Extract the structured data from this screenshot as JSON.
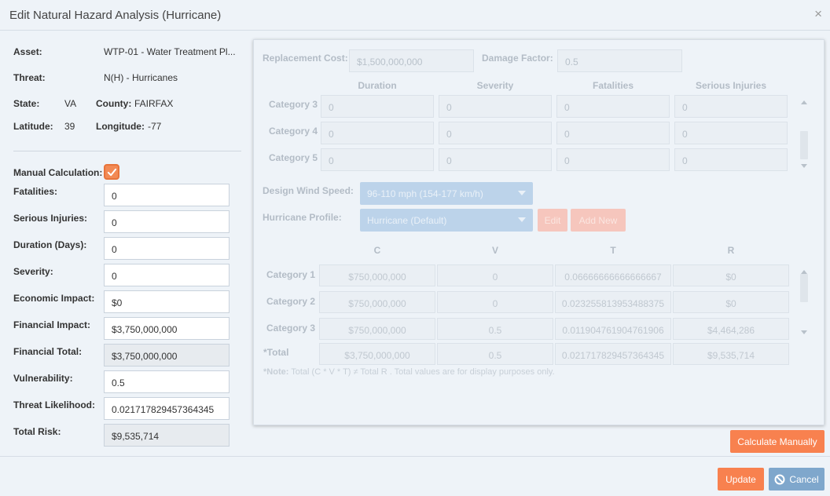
{
  "dialog": {
    "title": "Edit Natural Hazard Analysis (Hurricane)",
    "close_glyph": "×"
  },
  "info": {
    "asset_label": "Asset:",
    "asset_value": "WTP-01 - Water Treatment Pl...",
    "threat_label": "Threat:",
    "threat_value": "N(H) - Hurricanes",
    "state_label": "State:",
    "state_value": "VA",
    "county_label": "County:",
    "county_value": "FAIRFAX",
    "latitude_label": "Latitude:",
    "latitude_value": "39",
    "longitude_label": "Longitude:",
    "longitude_value": "-77"
  },
  "form": {
    "manual_calc_label": "Manual Calculation:",
    "manual_calc_checked": true,
    "fields": [
      {
        "label": "Fatalities:",
        "value": "0"
      },
      {
        "label": "Serious Injuries:",
        "value": "0"
      },
      {
        "label": "Duration (Days):",
        "value": "0"
      },
      {
        "label": "Severity:",
        "value": "0"
      },
      {
        "label": "Economic Impact:",
        "value": "$0"
      },
      {
        "label": "Financial Impact:",
        "value": "$3,750,000,000"
      },
      {
        "label": "Financial Total:",
        "value": "$3,750,000,000"
      },
      {
        "label": "Vulnerability:",
        "value": "0.5"
      },
      {
        "label": "Threat Likelihood:",
        "value": "0.021717829457364345"
      },
      {
        "label": "Total Risk:",
        "value": "$9,535,714"
      }
    ]
  },
  "panel": {
    "replacement_cost_label": "Replacement Cost:",
    "replacement_cost_value": "$1,500,000,000",
    "damage_factor_label": "Damage Factor:",
    "damage_factor_value": "0.5",
    "category_headers": [
      "Duration",
      "Severity",
      "Fatalities",
      "Serious Injuries"
    ],
    "category_rows": [
      {
        "label": "Category 3",
        "values": [
          "0",
          "0",
          "0",
          "0"
        ]
      },
      {
        "label": "Category 4",
        "values": [
          "0",
          "0",
          "0",
          "0"
        ]
      },
      {
        "label": "Category 5",
        "values": [
          "0",
          "0",
          "0",
          "0"
        ]
      }
    ],
    "wind_speed_label": "Design Wind Speed:",
    "wind_speed_value": "96-110 mph (154-177 km/h)",
    "profile_label": "Hurricane Profile:",
    "profile_value": "Hurricane (Default)",
    "edit_label": "Edit",
    "add_new_label": "Add New",
    "cvtr_headers": [
      "C",
      "V",
      "T",
      "R"
    ],
    "cvtr_rows": [
      {
        "label": "Category 1",
        "values": [
          "$750,000,000",
          "0",
          "0.06666666666666667",
          "$0"
        ]
      },
      {
        "label": "Category 2",
        "values": [
          "$750,000,000",
          "0",
          "0.023255813953488375",
          "$0"
        ]
      },
      {
        "label": "Category 3",
        "values": [
          "$750,000,000",
          "0.5",
          "0.011904761904761906",
          "$4,464,286"
        ]
      }
    ],
    "total_label": "*Total",
    "total_values": [
      "$3,750,000,000",
      "0.5",
      "0.021717829457364345",
      "$9,535,714"
    ],
    "note_bold": "*Note:",
    "note_text": " Total (C * V * T) ≠ Total R . Total values are for display purposes only."
  },
  "buttons": {
    "calculate_manually": "Calculate Manually",
    "update": "Update",
    "cancel": "Cancel"
  },
  "colors": {
    "accent": "#f8814f",
    "secondary": "#7fa7cc",
    "background": "#eef3f8"
  }
}
